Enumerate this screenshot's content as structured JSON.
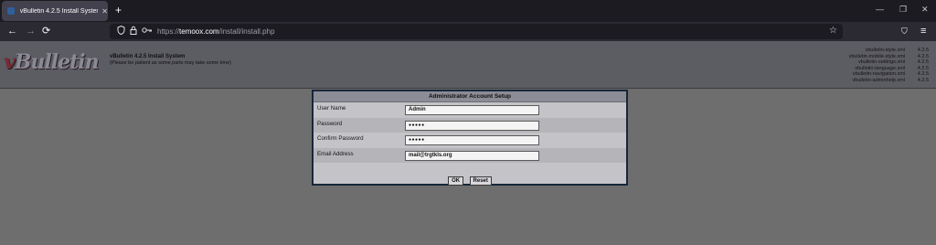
{
  "browser": {
    "tab_title": "vBulletin 4.2.5 Install System",
    "tab_close": "✕",
    "new_tab": "+",
    "window_controls": [
      "—",
      "❐",
      "✕"
    ],
    "back": "←",
    "forward": "→",
    "reload": "⟳",
    "url_protocol": "https://",
    "url_host": "temoox.com",
    "url_path": "/install/install.php",
    "bookmark_star": "☆",
    "pocket": "⛉",
    "menu": "≡"
  },
  "header": {
    "logo_v": "v",
    "logo_rest": "Bulletin",
    "title": "vBulletin 4.2.5 Install System",
    "subtitle": "(Please be patient as some parts may take some time)",
    "files": [
      {
        "name": "vbulletin-style.xml",
        "version": "4.2.5"
      },
      {
        "name": "vbulletin-mobile-style.xml",
        "version": "4.2.5"
      },
      {
        "name": "vbulletin-settings.xml",
        "version": "4.2.5"
      },
      {
        "name": "vbulletin-language.xml",
        "version": "4.2.5"
      },
      {
        "name": "vbulletin-navigation.xml",
        "version": "4.2.5"
      },
      {
        "name": "vbulletin-adminhelp.xml",
        "version": "4.2.5"
      }
    ]
  },
  "dialog": {
    "title": "Administrator Account Setup",
    "fields": [
      {
        "label": "User Name",
        "value": "Admin"
      },
      {
        "label": "Password",
        "value": "●●●●●"
      },
      {
        "label": "Confirm Password",
        "value": "●●●●●"
      },
      {
        "label": "Email Address",
        "value": "mail@trgtkls.org"
      }
    ],
    "ok_label": "OK",
    "reset_label": "Reset"
  }
}
